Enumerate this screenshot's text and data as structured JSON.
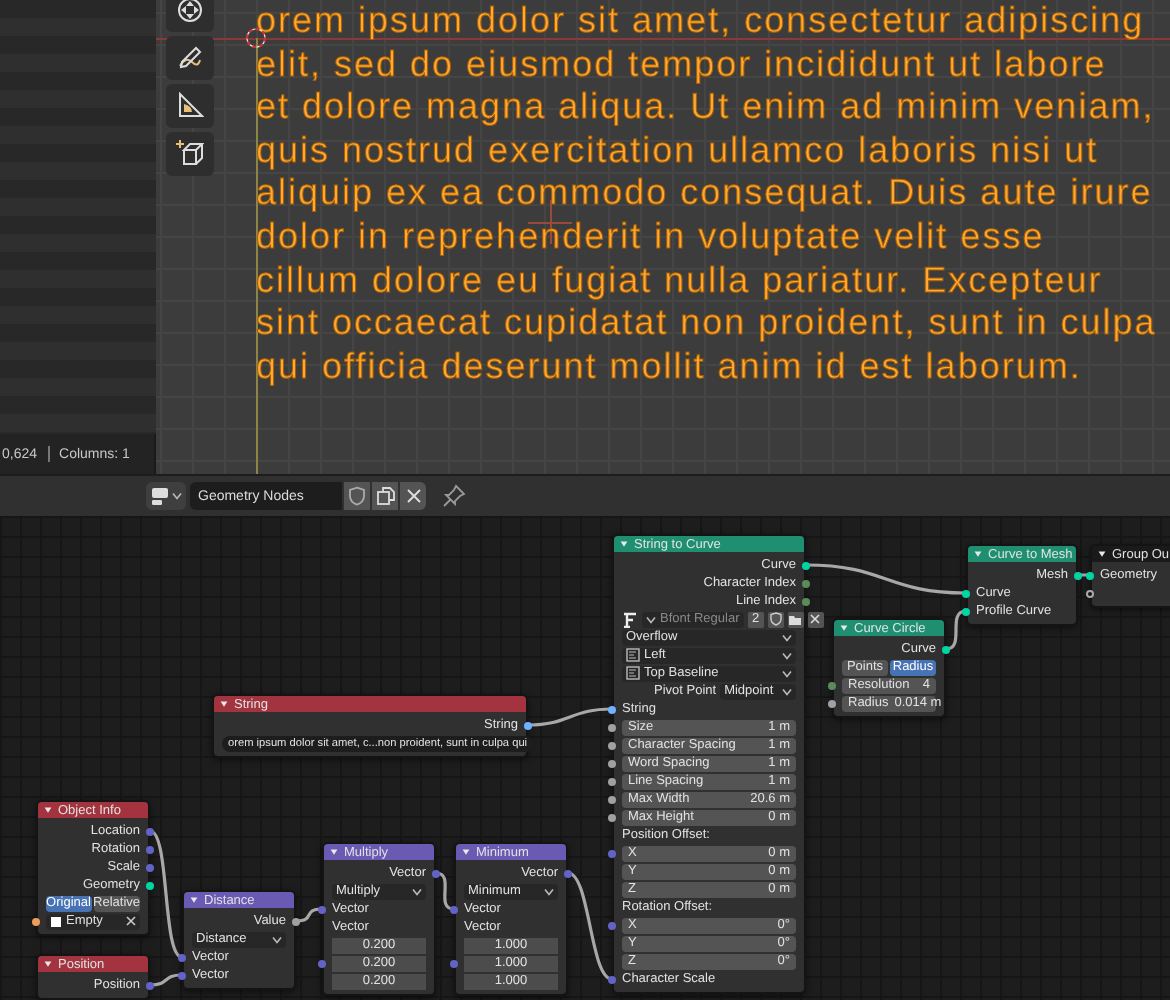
{
  "viewport": {
    "text": "orem ipsum dolor sit amet, consectetur adipiscing\nelit, sed do eiusmod tempor incididunt ut labore\net dolore magna aliqua. Ut enim ad minim veniam,\nquis nostrud exercitation ullamco laboris nisi ut\naliquip ex ea commodo consequat. Duis aute irure\ndolor in reprehenderit in voluptate velit esse\ncillum dolore eu fugiat nulla pariatur. Excepteur\nsint occaecat cupidatat non proident, sunt in culpa\nqui officia deserunt mollit anim id est laborum.",
    "status": [
      "0,624",
      "Columns: 1"
    ]
  },
  "node_editor": {
    "tree_name": "Geometry Nodes",
    "nodes": [
      {
        "title": "String to Curve",
        "color": "#1f8f71",
        "rows": [
          {
            "kind": "output",
            "label": "Curve",
            "color": "#00d6a3"
          },
          {
            "kind": "output",
            "label": "Character Index",
            "color": "#598c5c"
          },
          {
            "kind": "output",
            "label": "Line Index",
            "color": "#598c5c"
          },
          {
            "kind": "font",
            "value": "Bfont Regular",
            "users": "2"
          },
          {
            "kind": "dropdown",
            "value": "Overflow",
            "has_icon": false
          },
          {
            "kind": "dropdown",
            "value": "Left",
            "has_icon": true
          },
          {
            "kind": "dropdown",
            "value": "Top Baseline",
            "has_icon": true
          },
          {
            "kind": "labeled_dropdown",
            "label": "Pivot Point",
            "value": "Midpoint"
          },
          {
            "kind": "input",
            "label": "String",
            "color": "#70b2ff"
          },
          {
            "kind": "field",
            "label": "Size",
            "value": "1 m",
            "color": "#a1a1a1"
          },
          {
            "kind": "field",
            "label": "Character Spacing",
            "value": "1 m",
            "color": "#a1a1a1"
          },
          {
            "kind": "field",
            "label": "Word Spacing",
            "value": "1 m",
            "color": "#a1a1a1"
          },
          {
            "kind": "field",
            "label": "Line Spacing",
            "value": "1 m",
            "color": "#a1a1a1"
          },
          {
            "kind": "field",
            "label": "Max Width",
            "value": "20.6 m",
            "color": "#a1a1a1"
          },
          {
            "kind": "field",
            "label": "Max Height",
            "value": "0 m",
            "color": "#a1a1a1"
          },
          {
            "kind": "heading",
            "label": "Position Offset:"
          },
          {
            "kind": "field",
            "label": "X",
            "value": "0 m",
            "color": "#6363c7"
          },
          {
            "kind": "field",
            "label": "Y",
            "value": "0 m"
          },
          {
            "kind": "field",
            "label": "Z",
            "value": "0 m"
          },
          {
            "kind": "heading",
            "label": "Rotation Offset:"
          },
          {
            "kind": "field",
            "label": "X",
            "value": "0°",
            "color": "#6363c7"
          },
          {
            "kind": "field",
            "label": "Y",
            "value": "0°"
          },
          {
            "kind": "field",
            "label": "Z",
            "value": "0°"
          },
          {
            "kind": "input",
            "label": "Character Scale",
            "color": "#6363c7"
          }
        ]
      },
      {
        "title": "Curve to Mesh",
        "color": "#1f8f71",
        "rows": [
          {
            "kind": "output",
            "label": "Mesh",
            "color": "#00d6a3"
          },
          {
            "kind": "input",
            "label": "Curve",
            "color": "#00d6a3"
          },
          {
            "kind": "input",
            "label": "Profile Curve",
            "color": "#00d6a3"
          }
        ]
      },
      {
        "title": "Group Ou",
        "color": "#1a1a1a",
        "rows": [
          {
            "kind": "input",
            "label": "Geometry",
            "color": "#00d6a3"
          },
          {
            "kind": "empty_input"
          }
        ]
      },
      {
        "title": "Curve Circle",
        "color": "#1f8f71",
        "rows": [
          {
            "kind": "output",
            "label": "Curve",
            "color": "#00d6a3"
          },
          {
            "kind": "toggle",
            "options": [
              {
                "label": "Points",
                "selected": false
              },
              {
                "label": "Radius",
                "selected": true
              }
            ]
          },
          {
            "kind": "field",
            "label": "Resolution",
            "value": "4",
            "color": "#598c5c"
          },
          {
            "kind": "field",
            "label": "Radius",
            "value": "0.014 m",
            "color": "#a1a1a1"
          }
        ]
      },
      {
        "title": "String",
        "color": "#a3343f",
        "rows": [
          {
            "kind": "output",
            "label": "String",
            "color": "#70b2ff"
          },
          {
            "kind": "text_field",
            "value": "orem ipsum dolor sit amet, c...non proident, sunt in culpa qui"
          }
        ]
      },
      {
        "title": "Object Info",
        "color": "#a3343f",
        "rows": [
          {
            "kind": "output",
            "label": "Location",
            "color": "#6363c7"
          },
          {
            "kind": "output",
            "label": "Rotation",
            "color": "#6363c7"
          },
          {
            "kind": "output",
            "label": "Scale",
            "color": "#6363c7"
          },
          {
            "kind": "output",
            "label": "Geometry",
            "color": "#00d6a3"
          },
          {
            "kind": "toggle",
            "options": [
              {
                "label": "Original",
                "selected": true
              },
              {
                "label": "Relative",
                "selected": false
              }
            ]
          },
          {
            "kind": "object",
            "value": "Empty",
            "color": "#ed9e5c"
          }
        ]
      },
      {
        "title": "Position",
        "color": "#a3343f",
        "rows": [
          {
            "kind": "output",
            "label": "Position",
            "color": "#6363c7"
          }
        ]
      },
      {
        "title": "Distance",
        "color": "#6a5ab3",
        "rows": [
          {
            "kind": "output",
            "label": "Value",
            "color": "#a1a1a1"
          },
          {
            "kind": "dropdown",
            "value": "Distance",
            "has_icon": false
          },
          {
            "kind": "input",
            "label": "Vector",
            "color": "#6363c7"
          },
          {
            "kind": "input",
            "label": "Vector",
            "color": "#6363c7"
          }
        ]
      },
      {
        "title": "Multiply",
        "color": "#6a5ab3",
        "rows": [
          {
            "kind": "output",
            "label": "Vector",
            "color": "#6363c7"
          },
          {
            "kind": "dropdown",
            "value": "Multiply",
            "has_icon": false
          },
          {
            "kind": "input",
            "label": "Vector",
            "color": "#6363c7"
          },
          {
            "kind": "heading",
            "label": "Vector"
          },
          {
            "kind": "number",
            "value": "0.200"
          },
          {
            "kind": "number",
            "value": "0.200",
            "color": "#6363c7"
          },
          {
            "kind": "number",
            "value": "0.200"
          }
        ]
      },
      {
        "title": "Minimum",
        "color": "#6a5ab3",
        "rows": [
          {
            "kind": "output",
            "label": "Vector",
            "color": "#6363c7"
          },
          {
            "kind": "dropdown",
            "value": "Minimum",
            "has_icon": false
          },
          {
            "kind": "input",
            "label": "Vector",
            "color": "#6363c7"
          },
          {
            "kind": "heading",
            "label": "Vector"
          },
          {
            "kind": "number",
            "value": "1.000"
          },
          {
            "kind": "number",
            "value": "1.000",
            "color": "#6363c7"
          },
          {
            "kind": "number",
            "value": "1.000"
          }
        ]
      }
    ]
  }
}
